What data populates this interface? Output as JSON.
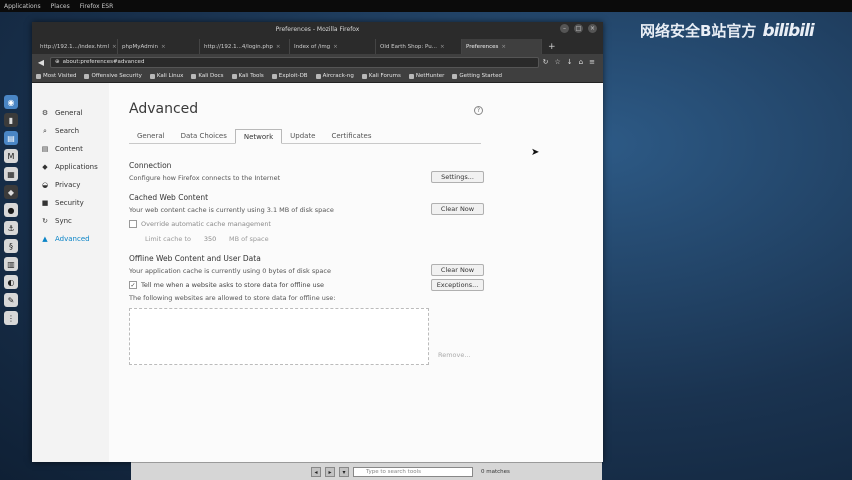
{
  "topbar": {
    "apps": "Applications",
    "places": "Places",
    "app": "Firefox ESR",
    "clock": "",
    "tray": ""
  },
  "watermark": {
    "text": "网络安全B站官方",
    "logo": "bilibili"
  },
  "window": {
    "title": "Preferences - Mozilla Firefox"
  },
  "tabs": [
    {
      "label": "http://192.1.../index.html"
    },
    {
      "label": "phpMyAdmin"
    },
    {
      "label": "http://192.1...4/login.php"
    },
    {
      "label": "Index of /img"
    },
    {
      "label": "Old Earth Shop: Pu..."
    },
    {
      "label": "Preferences"
    }
  ],
  "navbar": {
    "url": "about:preferences#advanced",
    "identity": "Firefox"
  },
  "bookmarks": [
    "Most Visited",
    "Offensive Security",
    "Kali Linux",
    "Kali Docs",
    "Kali Tools",
    "Exploit-DB",
    "Aircrack-ng",
    "Kali Forums",
    "NetHunter",
    "Getting Started"
  ],
  "sidebar": {
    "items": [
      {
        "label": "General",
        "icon": "gear-icon"
      },
      {
        "label": "Search",
        "icon": "search-icon"
      },
      {
        "label": "Content",
        "icon": "document-icon"
      },
      {
        "label": "Applications",
        "icon": "apps-icon"
      },
      {
        "label": "Privacy",
        "icon": "mask-icon"
      },
      {
        "label": "Security",
        "icon": "lock-icon"
      },
      {
        "label": "Sync",
        "icon": "sync-icon"
      },
      {
        "label": "Advanced",
        "icon": "wizard-hat-icon"
      }
    ]
  },
  "pane": {
    "title": "Advanced",
    "help": "?",
    "tabs": [
      "General",
      "Data Choices",
      "Network",
      "Update",
      "Certificates"
    ],
    "connection": {
      "title": "Connection",
      "desc": "Configure how Firefox connects to the Internet",
      "button": "Settings..."
    },
    "cache": {
      "title": "Cached Web Content",
      "desc": "Your web content cache is currently using 3.1 MB of disk space",
      "button": "Clear Now",
      "override_label": "Override automatic cache management",
      "limit_label": "Limit cache to",
      "limit_value": "350",
      "limit_unit": "MB of space"
    },
    "offline": {
      "title": "Offline Web Content and User Data",
      "desc": "Your application cache is currently using 0 bytes of disk space",
      "clear_button": "Clear Now",
      "tell_me_label": "Tell me when a website asks to store data for offline use",
      "tell_me_checked": true,
      "exceptions_button": "Exceptions...",
      "allowed_label": "The following websites are allowed to store data for offline use:",
      "remove_button": "Remove..."
    }
  },
  "findbar": {
    "placeholder": "Type to search tools",
    "count": "0 matches"
  }
}
